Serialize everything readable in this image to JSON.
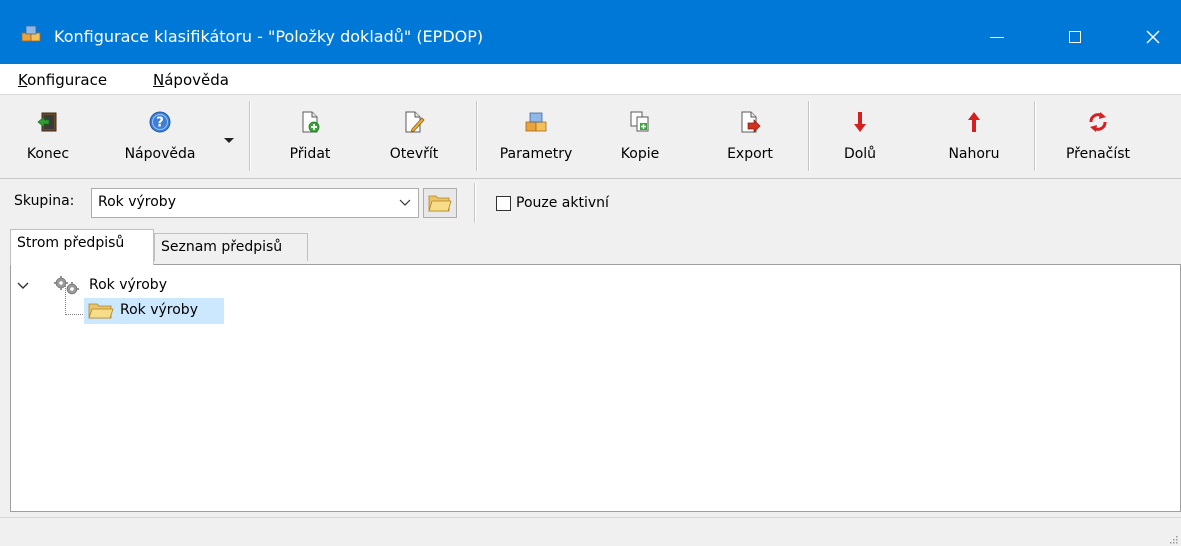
{
  "window": {
    "title": "Konfigurace klasifikátoru - \"Položky dokladů\" (EPDOP)",
    "icon": "app-boxes-icon",
    "colors": {
      "titlebar": "#0078d7",
      "selection": "#cce8ff"
    }
  },
  "menu": {
    "items": [
      {
        "label_u": "K",
        "label_rest": "onfigurace"
      },
      {
        "label_u": "N",
        "label_rest": "ápověda"
      }
    ]
  },
  "toolbar": {
    "buttons": [
      {
        "label": "Konec",
        "icon": "exit-door-icon"
      },
      {
        "label": "Nápověda",
        "icon": "help-icon"
      },
      {
        "label": "Přidat",
        "icon": "new-document-icon"
      },
      {
        "label": "Otevřít",
        "icon": "edit-document-icon"
      },
      {
        "label": "Parametry",
        "icon": "parameters-boxes-icon"
      },
      {
        "label": "Kopie",
        "icon": "copy-icon"
      },
      {
        "label": "Export",
        "icon": "export-icon"
      },
      {
        "label": "Dolů",
        "icon": "arrow-down-icon"
      },
      {
        "label": "Nahoru",
        "icon": "arrow-up-icon"
      },
      {
        "label": "Přenačíst",
        "icon": "reload-icon"
      }
    ]
  },
  "group": {
    "label": "Skupina:",
    "value": "Rok výroby",
    "checkbox_label": "Pouze aktivní",
    "checkbox_checked": false
  },
  "tabs": [
    {
      "label": "Strom předpisů",
      "active": true
    },
    {
      "label": "Seznam předpisů",
      "active": false
    }
  ],
  "tree": {
    "root": {
      "label": "Rok výroby",
      "expanded": true,
      "icon": "gears-icon"
    },
    "children": [
      {
        "label": "Rok výroby",
        "selected": true,
        "icon": "folder-icon"
      }
    ]
  }
}
